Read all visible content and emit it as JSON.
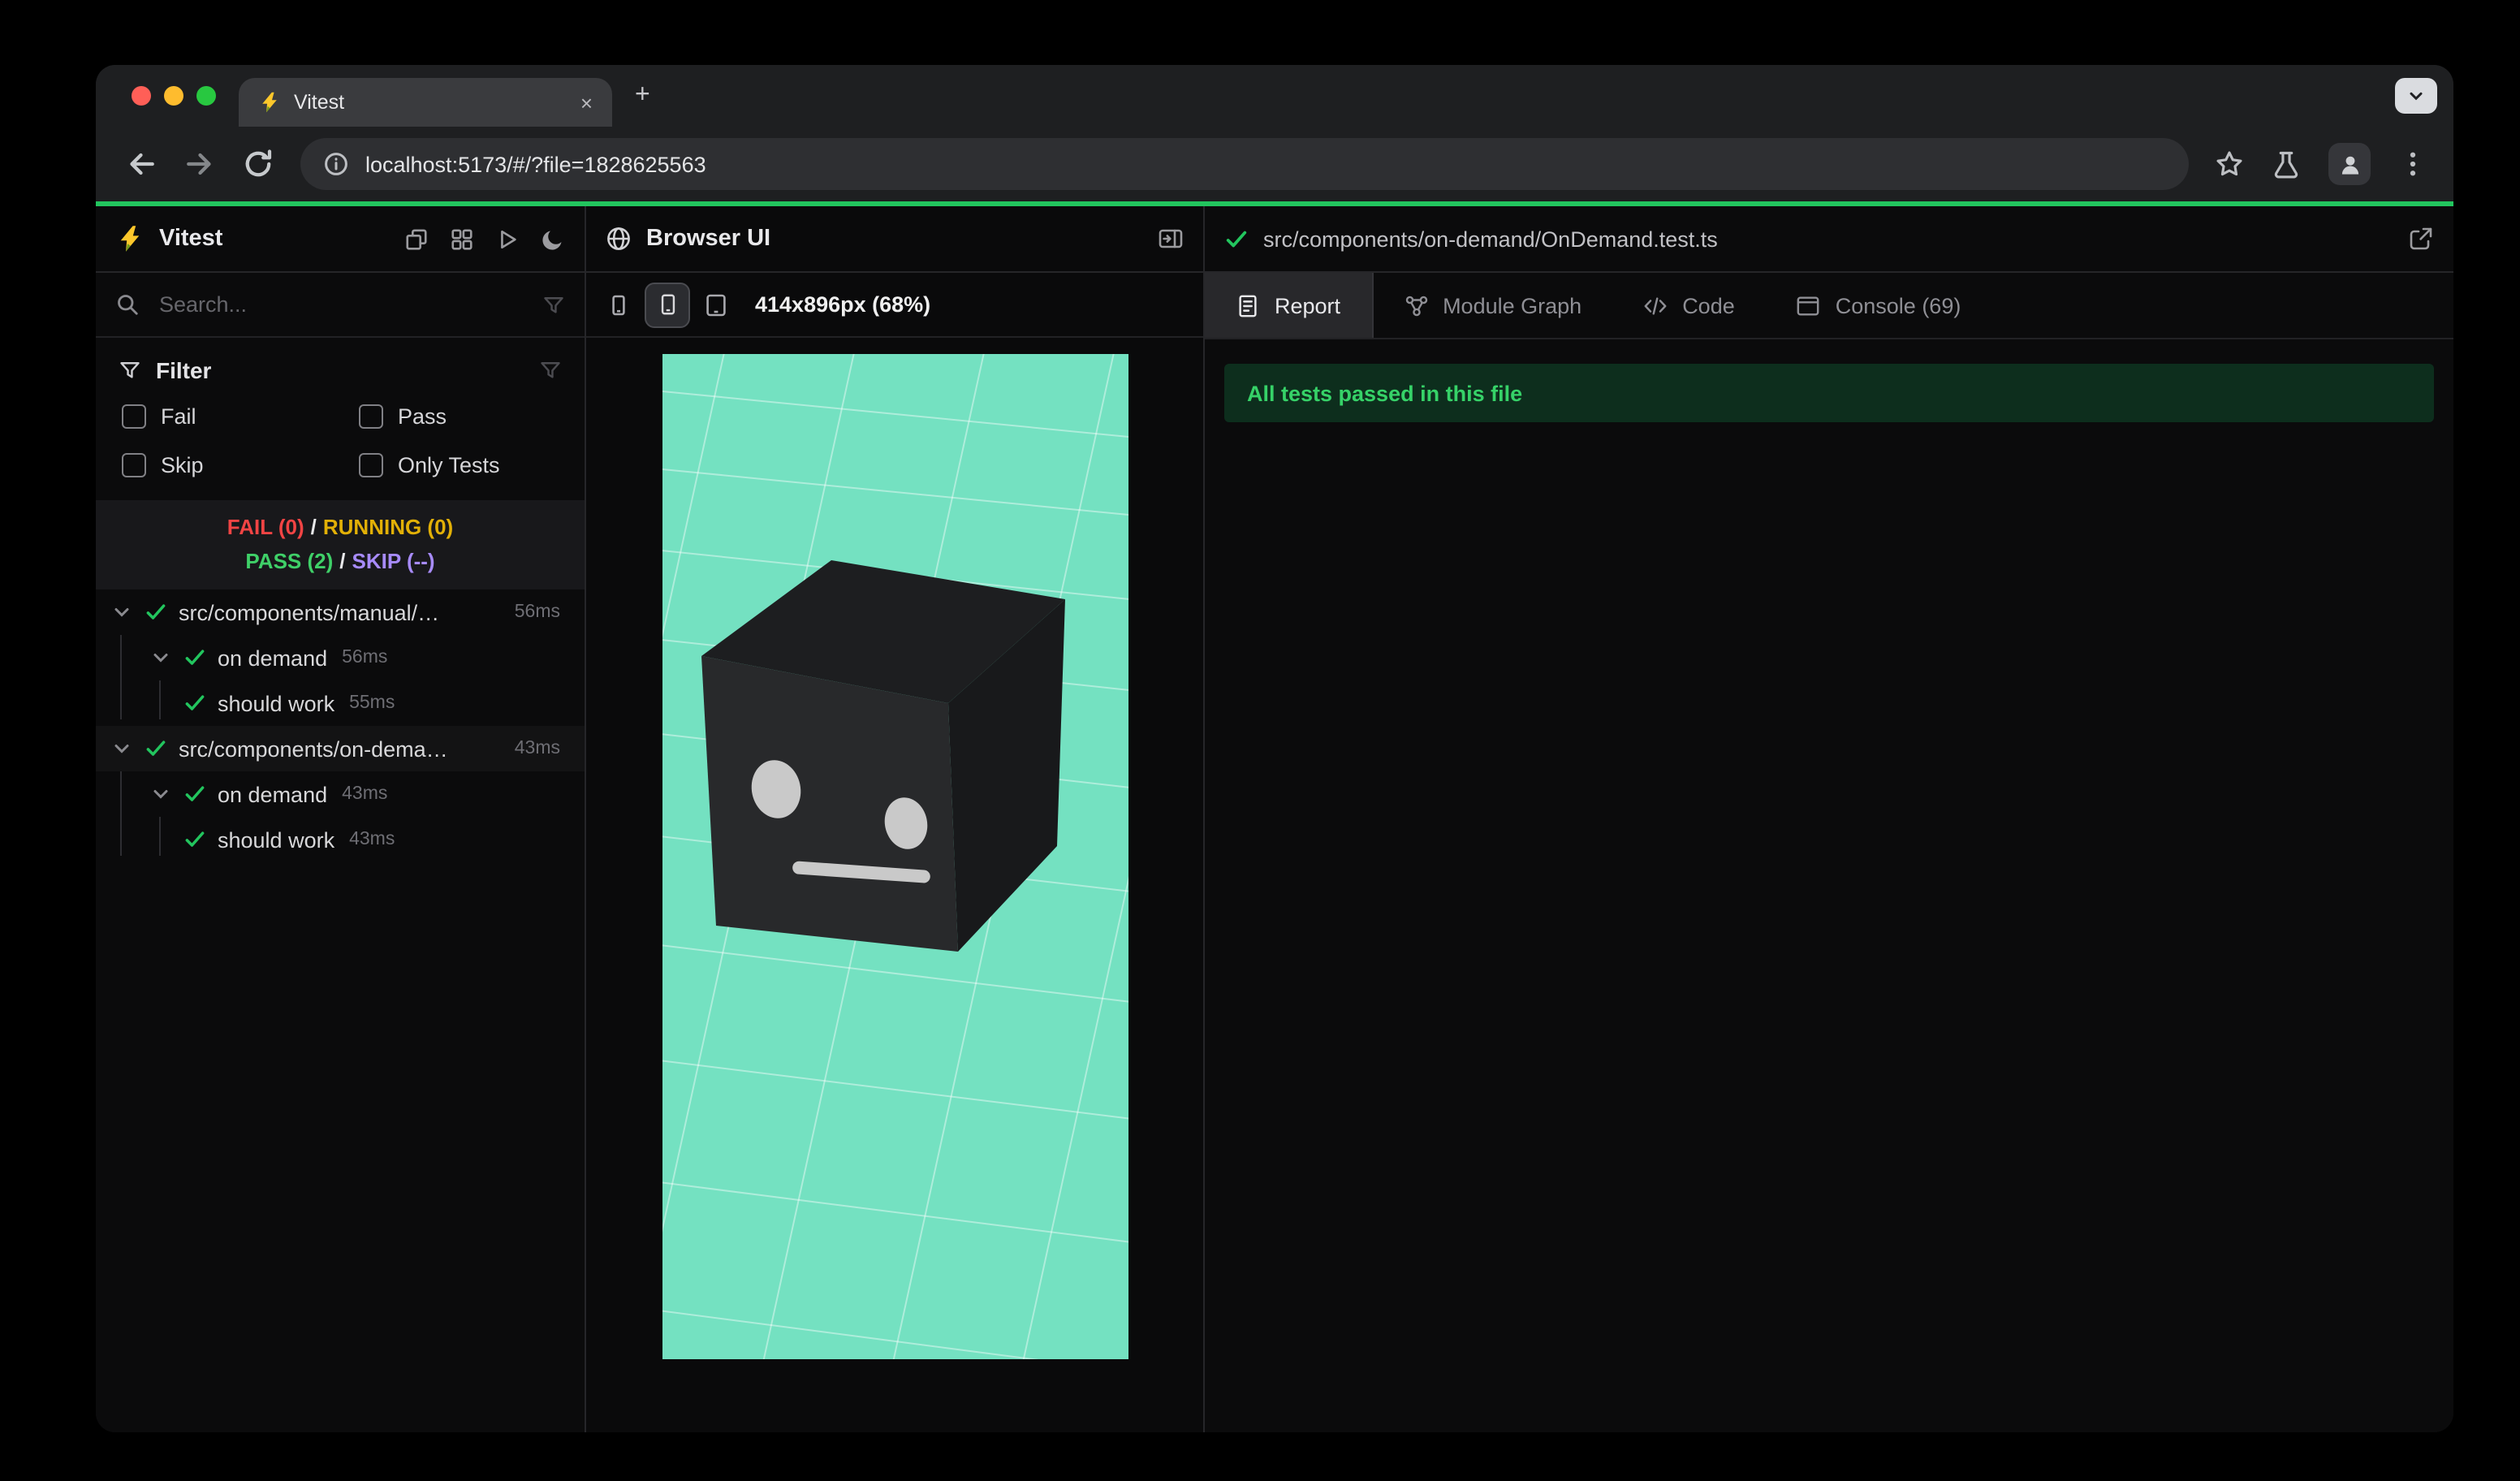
{
  "window": {
    "tab_title": "Vitest",
    "tab_close": "×",
    "new_tab": "+",
    "url": "localhost:5173/#/?file=1828625563"
  },
  "sidebar": {
    "app_name": "Vitest",
    "search_placeholder": "Search...",
    "filter": {
      "title": "Filter",
      "options": [
        {
          "label": "Fail",
          "checked": false
        },
        {
          "label": "Pass",
          "checked": false
        },
        {
          "label": "Skip",
          "checked": false
        },
        {
          "label": "Only Tests",
          "checked": false
        }
      ]
    },
    "summary": {
      "fail": "FAIL (0)",
      "running": "RUNNING (0)",
      "pass": "PASS (2)",
      "skip": "SKIP (--)",
      "sep": "/"
    },
    "tree": [
      {
        "label": "src/components/manual/…",
        "time": "56ms",
        "level": 0,
        "status": "pass"
      },
      {
        "label": "on demand",
        "time": "56ms",
        "level": 1,
        "status": "pass"
      },
      {
        "label": "should work",
        "time": "55ms",
        "level": 2,
        "status": "pass"
      },
      {
        "label": "src/components/on-dema…",
        "time": "43ms",
        "level": 0,
        "status": "pass"
      },
      {
        "label": "on demand",
        "time": "43ms",
        "level": 1,
        "status": "pass"
      },
      {
        "label": "should work",
        "time": "43ms",
        "level": 2,
        "status": "pass"
      }
    ]
  },
  "preview": {
    "title": "Browser UI",
    "resolution": "414x896px (68%)"
  },
  "report": {
    "file_path": "src/components/on-demand/OnDemand.test.ts",
    "tabs": [
      {
        "label": "Report",
        "active": true
      },
      {
        "label": "Module Graph",
        "active": false
      },
      {
        "label": "Code",
        "active": false
      },
      {
        "label": "Console (69)",
        "active": false
      }
    ],
    "banner": "All tests passed in this file"
  },
  "colors": {
    "progress_green": "#22c55e",
    "pass_green": "#3fd068",
    "fail_red": "#f24444",
    "running_yellow": "#e2b007",
    "skip_purple": "#a78bfa",
    "banner_bg": "#0d2e1d",
    "viewport_mint": "#74e1c1",
    "vitest_yellow": "#fcc72b",
    "vitest_green": "#729b1b"
  },
  "icons": [
    "vitest-logo",
    "collapse-all",
    "dashboard",
    "run-all",
    "dark-mode-toggle",
    "search",
    "filter-funnel",
    "chevron-down",
    "check-pass",
    "globe",
    "panel-toggle",
    "device-mobile-small",
    "device-mobile",
    "device-tablet",
    "external-link",
    "report-doc",
    "module-graph",
    "code-brackets",
    "console-window",
    "back-arrow",
    "forward-arrow",
    "reload",
    "info",
    "bookmark-star",
    "experiments-flask",
    "profile-avatar",
    "overflow-menu",
    "new-tab-plus",
    "tab-search-chevron"
  ]
}
